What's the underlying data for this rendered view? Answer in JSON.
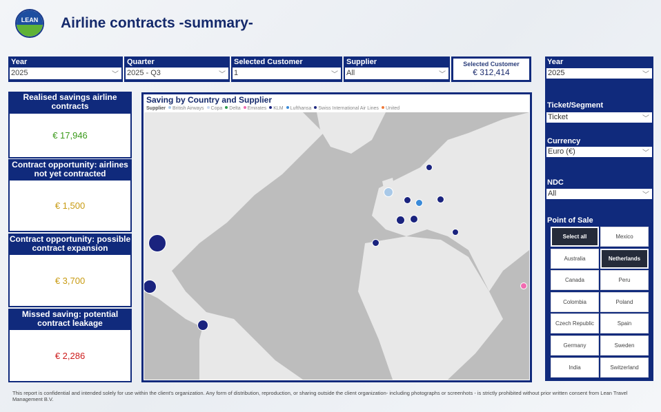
{
  "header": {
    "title": "Airline contracts -summary-",
    "logo_text": "LEAN"
  },
  "filters": [
    {
      "label": "Year",
      "value": "2025"
    },
    {
      "label": "Quarter",
      "value": "2025 - Q3"
    },
    {
      "label": "Selected Customer",
      "value": "1"
    },
    {
      "label": "Supplier",
      "value": "All"
    }
  ],
  "selected_customer_card": {
    "label": "Selected Customer",
    "value": "€ 312,414"
  },
  "kpis": [
    {
      "title": "Realised savings airline contracts",
      "value": "€ 17,946",
      "color": "#3a9a1a"
    },
    {
      "title": "Contract opportunity: airlines not yet contracted",
      "value": "€ 1,500",
      "color": "#c89a10"
    },
    {
      "title": "Contract opportunity: possible contract expansion",
      "value": "€ 3,700",
      "color": "#c89a10"
    },
    {
      "title": "Missed saving: potential contract leakage",
      "value": "€ 2,286",
      "color": "#cc1a1a"
    }
  ],
  "map": {
    "title": "Saving by Country and Supplier",
    "legend_label": "Supplier",
    "legend": [
      {
        "name": "British Airways",
        "color": "#a9c9e8"
      },
      {
        "name": "Copa",
        "color": "#c8d8f0"
      },
      {
        "name": "Delta",
        "color": "#2a9a4a"
      },
      {
        "name": "Emirates",
        "color": "#f06bb0"
      },
      {
        "name": "KLM",
        "color": "#1a237e"
      },
      {
        "name": "Lufthansa",
        "color": "#3a8ad8"
      },
      {
        "name": "Swiss International Air Lines",
        "color": "#202a80"
      },
      {
        "name": "United",
        "color": "#f07a3a"
      }
    ]
  },
  "right_panel": {
    "year": {
      "label": "Year",
      "value": "2025"
    },
    "ticket": {
      "label": "Ticket/Segment",
      "value": "Ticket"
    },
    "currency": {
      "label": "Currency",
      "value": "Euro (€)"
    },
    "ndc": {
      "label": "NDC",
      "value": "All"
    },
    "pos": {
      "label": "Point of Sale",
      "items": [
        {
          "label": "Select all",
          "selected": true
        },
        {
          "label": "Mexico",
          "selected": false
        },
        {
          "label": "Australia",
          "selected": false
        },
        {
          "label": "Netherlands",
          "selected": true
        },
        {
          "label": "Canada",
          "selected": false
        },
        {
          "label": "Peru",
          "selected": false
        },
        {
          "label": "Colombia",
          "selected": false
        },
        {
          "label": "Poland",
          "selected": false
        },
        {
          "label": "Czech Republic",
          "selected": false
        },
        {
          "label": "Spain",
          "selected": false
        },
        {
          "label": "Germany",
          "selected": false
        },
        {
          "label": "Sweden",
          "selected": false
        },
        {
          "label": "India",
          "selected": false
        },
        {
          "label": "Switzerland",
          "selected": false
        }
      ]
    }
  },
  "disclaimer": "This report is confidential and intended solely for use within the client's organization. Any form of distribution, reproduction, or sharing outside the client organization- including photographs or screenhots - is strictly prohibited without prior written consent from Lean Travel Management B.V."
}
